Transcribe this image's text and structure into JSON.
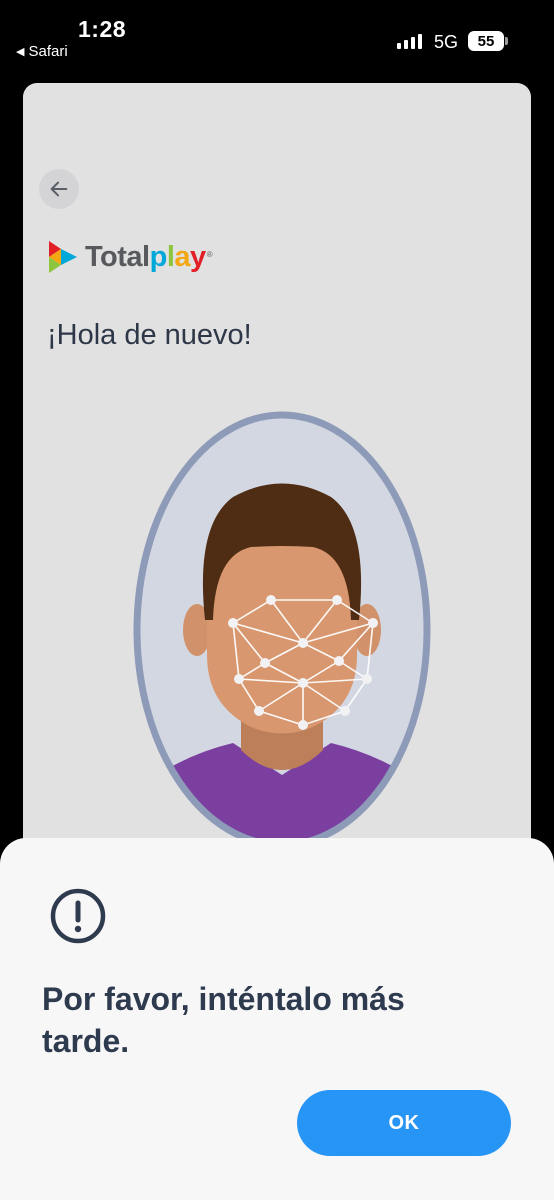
{
  "status_bar": {
    "time": "1:28",
    "back_app": "Safari",
    "network": "5G",
    "battery": "55"
  },
  "page": {
    "logo": {
      "total": "Total",
      "p": "p",
      "l": "l",
      "a": "a",
      "y": "y",
      "reg": "®"
    },
    "greeting": "¡Hola de nuevo!"
  },
  "dialog": {
    "message": "Por favor, inténtalo más tarde.",
    "ok_label": "OK"
  },
  "colors": {
    "accent": "#2795f5",
    "title": "#2e3a4e",
    "shirt": "#7b3fa0",
    "oval_border": "#8e9bb8"
  }
}
